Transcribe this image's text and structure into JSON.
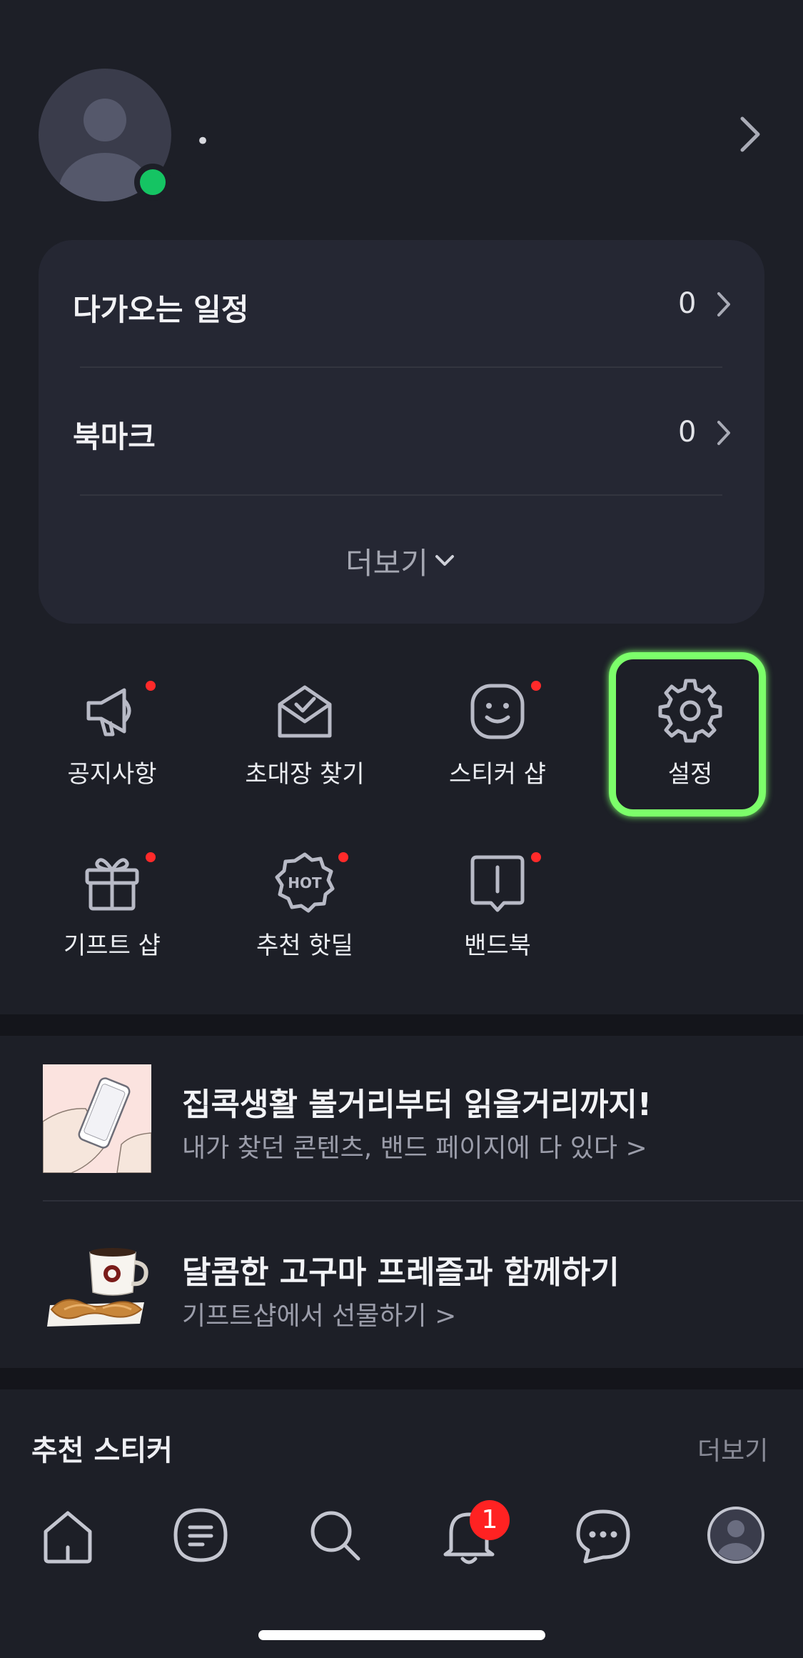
{
  "profile": {
    "name": "•",
    "online_color": "#15c463"
  },
  "summary": {
    "rows": [
      {
        "label": "다가오는 일정",
        "count": "0"
      },
      {
        "label": "북마크",
        "count": "0"
      }
    ],
    "more_label": "더보기"
  },
  "quick_menu": {
    "items": [
      {
        "label": "공지사항",
        "icon": "megaphone-icon",
        "has_dot": true
      },
      {
        "label": "초대장 찾기",
        "icon": "envelope-check-icon",
        "has_dot": false
      },
      {
        "label": "스티커 샵",
        "icon": "smiley-icon",
        "has_dot": true
      },
      {
        "label": "설정",
        "icon": "gear-icon",
        "has_dot": false,
        "highlighted": true
      },
      {
        "label": "기프트 샵",
        "icon": "gift-icon",
        "has_dot": true
      },
      {
        "label": "추천 핫딜",
        "icon": "hot-badge-icon",
        "has_dot": true,
        "icon_text": "HOT"
      },
      {
        "label": "밴드북",
        "icon": "book-icon",
        "has_dot": true
      }
    ],
    "highlight_color": "#7cff6a"
  },
  "promos": [
    {
      "title": "집콕생활 볼거리부터 읽을거리까지!",
      "subtitle": "내가 찾던 콘텐츠, 밴드 페이지에 다 있다 >"
    },
    {
      "title": "달콤한 고구마 프레즐과 함께하기",
      "subtitle": "기프트샵에서 선물하기 >"
    }
  ],
  "sticker_section": {
    "title": "추천 스티커",
    "more_label": "더보기"
  },
  "bottom_nav": {
    "items": [
      "home-icon",
      "feed-icon",
      "search-icon",
      "bell-icon",
      "chat-icon",
      "profile-icon"
    ],
    "notification_badge": "1"
  }
}
